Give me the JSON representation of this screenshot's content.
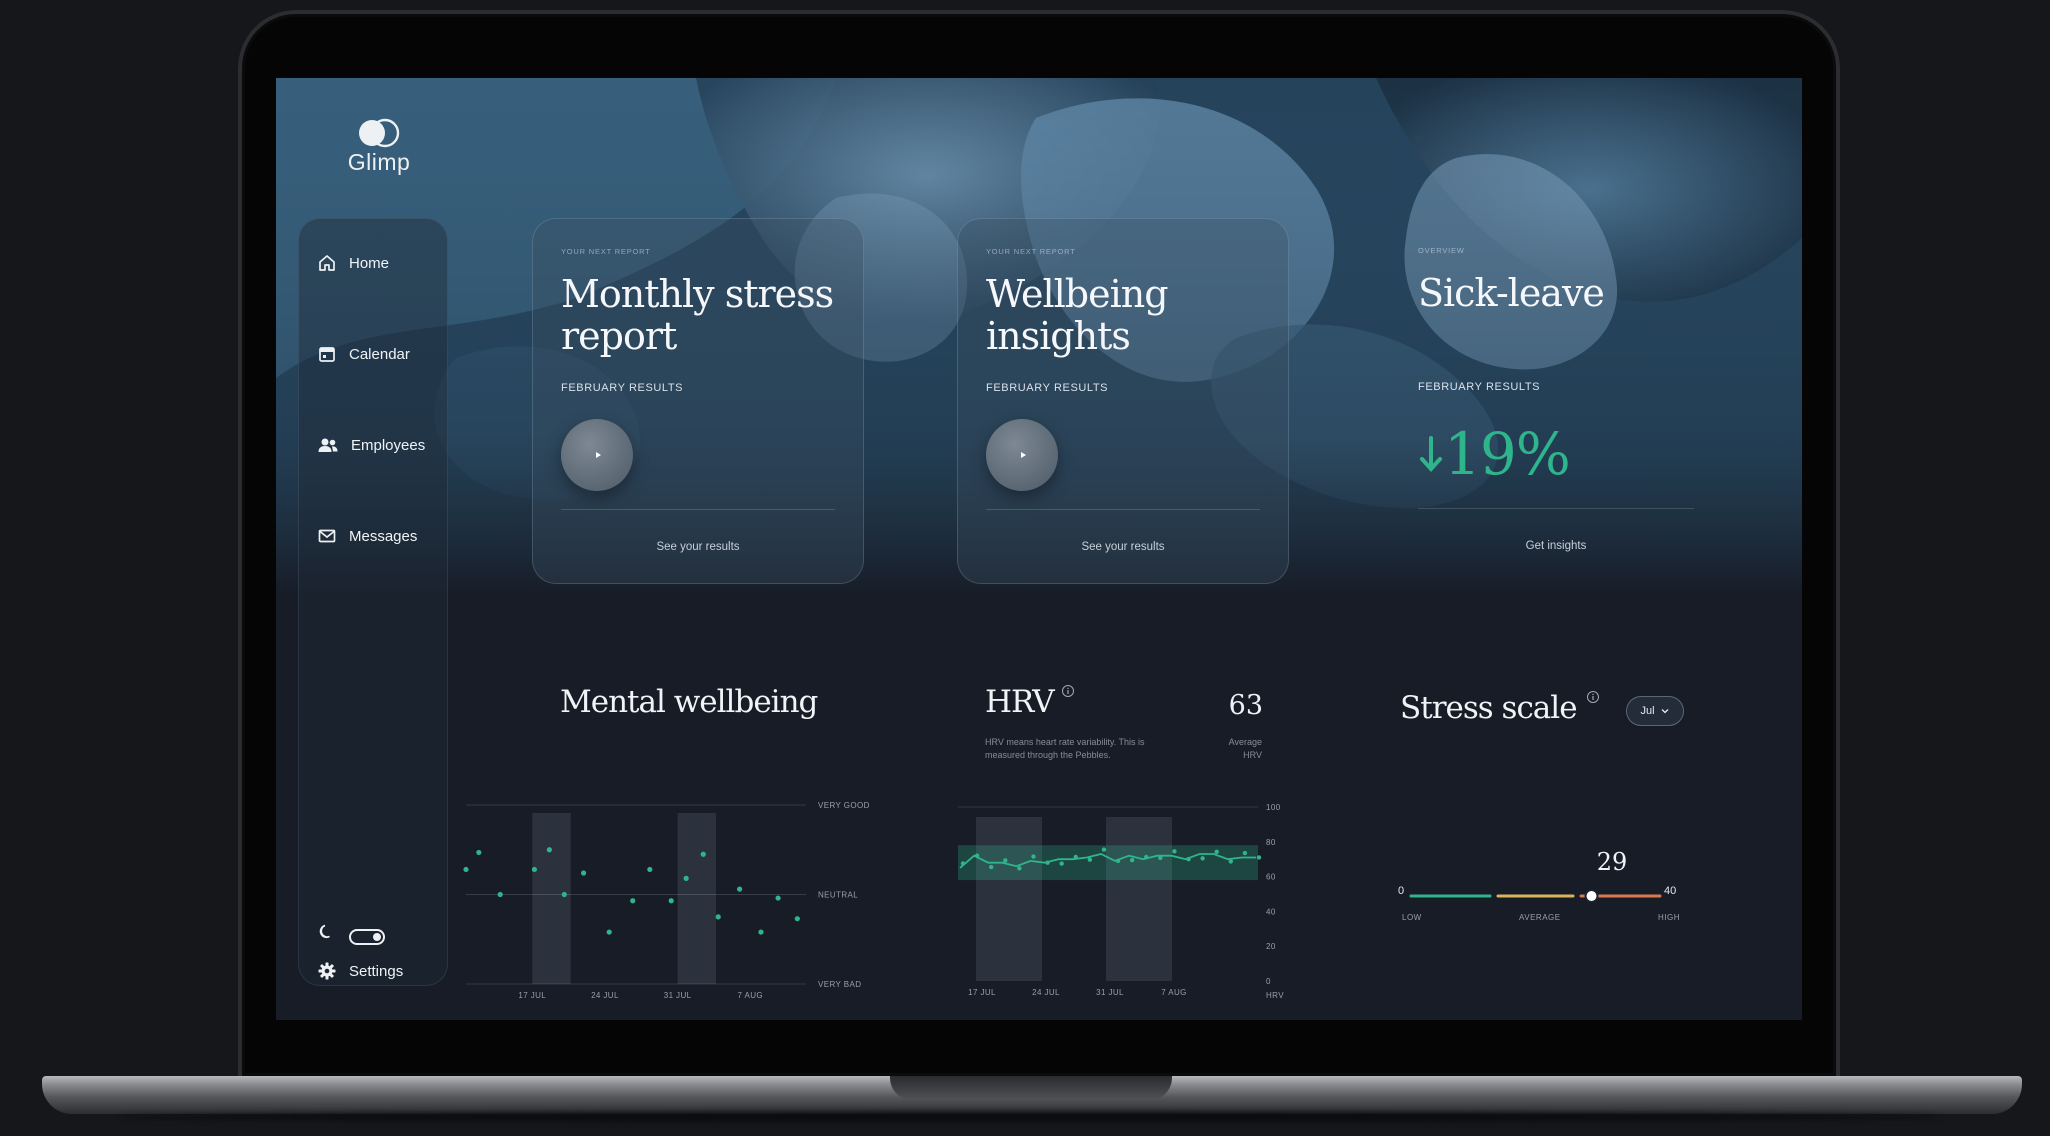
{
  "colors": {
    "accent_green": "#2fb58c",
    "gauge_low": "#2fb58c",
    "gauge_avg": "#d9b45a",
    "gauge_high": "#d9784e",
    "text_primary": "#f1f4f7"
  },
  "brand": {
    "name": "Glimp",
    "icon": "glimp-logo-icon"
  },
  "sidebar": {
    "items": [
      {
        "label": "Home",
        "icon": "home-icon"
      },
      {
        "label": "Calendar",
        "icon": "calendar-icon"
      },
      {
        "label": "Employees",
        "icon": "users-icon"
      },
      {
        "label": "Messages",
        "icon": "mail-icon"
      }
    ],
    "theme_toggle": {
      "icon": "moon-icon",
      "state": "on"
    },
    "settings": {
      "label": "Settings",
      "icon": "gear-icon"
    }
  },
  "cards": [
    {
      "eyebrow": "YOUR NEXT REPORT",
      "title": "Monthly stress report",
      "subtitle": "FEBRUARY RESULTS",
      "link": "See your results",
      "icon": "play-icon"
    },
    {
      "eyebrow": "YOUR NEXT REPORT",
      "title": "Wellbeing insights",
      "subtitle": "FEBRUARY RESULTS",
      "link": "See your results",
      "icon": "play-icon"
    },
    {
      "eyebrow": "OVERVIEW",
      "title": "Sick-leave",
      "subtitle": "FEBRUARY RESULTS",
      "value": "19%",
      "trend": "down",
      "link": "Get insights",
      "icon": "arrow-down-icon"
    }
  ],
  "mental_wellbeing": {
    "title": "Mental wellbeing",
    "chart_data": {
      "type": "scatter",
      "x_labels": [
        "17 JUL",
        "24 JUL",
        "31 JUL",
        "7 AUG"
      ],
      "y_labels": [
        "VERY GOOD",
        "NEUTRAL",
        "VERY BAD"
      ],
      "ylim": [
        -1,
        1
      ],
      "grid": "horizontal",
      "points": [
        {
          "x": 0.0,
          "y": 0.28
        },
        {
          "x": 0.3,
          "y": 0.47
        },
        {
          "x": 0.8,
          "y": 0.0
        },
        {
          "x": 1.6,
          "y": 0.28
        },
        {
          "x": 1.95,
          "y": 0.5
        },
        {
          "x": 2.3,
          "y": 0.0
        },
        {
          "x": 2.75,
          "y": 0.24
        },
        {
          "x": 3.35,
          "y": -0.42
        },
        {
          "x": 3.9,
          "y": -0.07
        },
        {
          "x": 4.3,
          "y": 0.28
        },
        {
          "x": 4.8,
          "y": -0.07
        },
        {
          "x": 5.15,
          "y": 0.18
        },
        {
          "x": 5.55,
          "y": 0.45
        },
        {
          "x": 5.9,
          "y": -0.25
        },
        {
          "x": 6.4,
          "y": 0.06
        },
        {
          "x": 6.9,
          "y": -0.42
        },
        {
          "x": 7.3,
          "y": -0.04
        },
        {
          "x": 7.75,
          "y": -0.27
        }
      ]
    }
  },
  "hrv": {
    "title": "HRV",
    "info_icon": "info-icon",
    "description": "HRV means heart rate variability. This is measured through the Pebbles.",
    "average_value": "63",
    "average_label": "Average HRV",
    "chart_data": {
      "type": "line",
      "x_labels": [
        "17 JUL",
        "24 JUL",
        "31 JUL",
        "7 AUG"
      ],
      "y_ticks": [
        100,
        80,
        60,
        40,
        20,
        0
      ],
      "ylim": [
        0,
        100
      ],
      "y_unit_label": "HRV",
      "band": [
        58,
        78
      ],
      "values": [
        65,
        72,
        68,
        68,
        66,
        69,
        68,
        70,
        70,
        71,
        73,
        69,
        72,
        70,
        72,
        72,
        70,
        73,
        73,
        70,
        71,
        71
      ]
    }
  },
  "stress_scale": {
    "title": "Stress scale",
    "info_icon": "info-icon",
    "period": "Jul",
    "value": "29",
    "min": "0",
    "max": "40",
    "value_num": 29,
    "max_num": 40,
    "labels": {
      "low": "LOW",
      "average": "AVERAGE",
      "high": "HIGH"
    }
  }
}
